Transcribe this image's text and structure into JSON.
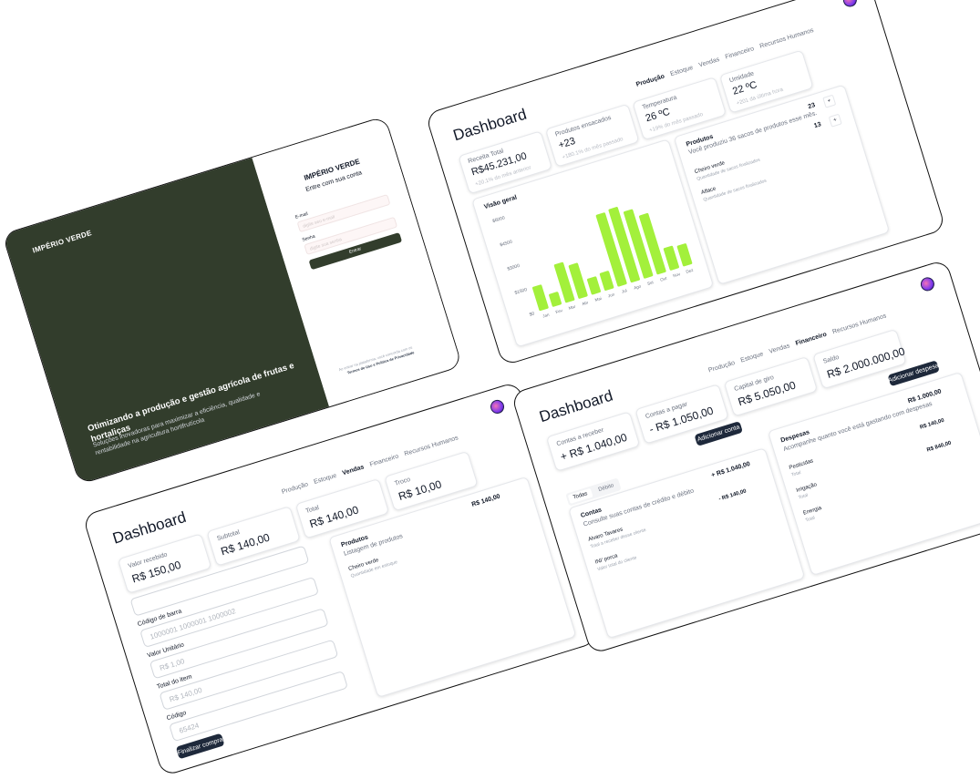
{
  "colors": {
    "brand_dark": "#323d2c",
    "accent_green": "#a3f03b",
    "button_dark": "#1e293b"
  },
  "login": {
    "brand": "IMPÉRIO VERDE",
    "headline": "Otimizando a produção e gestão agrícola de frutas e hortaliças",
    "tagline": "Soluções inovadoras para maximizar a eficiência, qualidade e rentabilidade na agricultura hortifrutícola",
    "form_brand": "IMPÉRIO VERDE",
    "form_subtitle": "Entre com sua conta",
    "email_label": "E-mail",
    "email_placeholder": "digite seu e-mail",
    "password_label": "Senha",
    "password_placeholder": "digite sua senha",
    "submit_label": "Entrar",
    "terms_line1": "Ao entrar na plataforma, você concorda com os",
    "terms_line2": "Termos de Uso e Política de Privacidade"
  },
  "production": {
    "nav": [
      "Produção",
      "Estoque",
      "Vendas",
      "Financeiro",
      "Recursos Humanos"
    ],
    "active_tab": "Produção",
    "title": "Dashboard",
    "kpis": [
      {
        "label": "Receita Total",
        "value": "R$45.231,00",
        "sub": "+20.1% do mês anterior"
      },
      {
        "label": "Produtos ensacados",
        "value": "+23",
        "sub": "+180.1% do mês passado"
      },
      {
        "label": "Temperatura",
        "value": "26 ºC",
        "sub": "+19% do mês passado"
      },
      {
        "label": "Umidade",
        "value": "22 ºC",
        "sub": "+201 da última hora"
      }
    ],
    "products_title": "Produtos",
    "products_desc": "Você produziu 36 sacos de produtos esse mês.",
    "products": [
      {
        "name": "Cheiro verde",
        "sub": "Quantidade de sacos finalizados",
        "qty": "23"
      },
      {
        "name": "Alface",
        "sub": "Quantidade de sacos finalizados",
        "qty": "13"
      }
    ]
  },
  "chart_data": {
    "type": "bar",
    "title": "Visão geral",
    "categories": [
      "Jan",
      "Fev",
      "Mar",
      "Abr",
      "Mai",
      "Jun",
      "Jul",
      "Ago",
      "Set",
      "Out",
      "Nov",
      "Dez"
    ],
    "values": [
      1500,
      800,
      2400,
      2100,
      1000,
      1100,
      4500,
      4600,
      4200,
      3700,
      1400,
      1300
    ],
    "yticks": [
      "$0",
      "$1500",
      "$3000",
      "$4500",
      "$6000"
    ],
    "ylim": [
      0,
      6000
    ],
    "color": "#a3f03b"
  },
  "sales": {
    "nav": [
      "Produção",
      "Estoque",
      "Vendas",
      "Financeiro",
      "Recursos Humanos"
    ],
    "active_tab": "Vendas",
    "title": "Dashboard",
    "kpis": [
      {
        "label": "Valor recebido",
        "value": "R$ 150,00"
      },
      {
        "label": "Subtotal",
        "value": "R$ 140,00"
      },
      {
        "label": "Total",
        "value": "R$ 140,00"
      },
      {
        "label": "Troco",
        "value": "R$ 10,00"
      }
    ],
    "fields": [
      {
        "label": "Código de barra",
        "placeholder": "1000001 1000001 1000002"
      },
      {
        "label": "Valor Unitário",
        "placeholder": "R$ 1,00"
      },
      {
        "label": "Total do item",
        "placeholder": "R$ 140,00"
      },
      {
        "label": "Código",
        "placeholder": "65424"
      }
    ],
    "finish_label": "Finalizar compra",
    "products_title": "Produtos",
    "products_total": "R$ 140,00",
    "products_desc": "Listagem de produtos",
    "item_name": "Cheiro verde",
    "item_sub": "Quantidade em estoque"
  },
  "finance": {
    "nav": [
      "Produção",
      "Estoque",
      "Vendas",
      "Financeiro",
      "Recursos Humanos"
    ],
    "active_tab": "Financeiro",
    "title": "Dashboard",
    "kpis": [
      {
        "label": "Contas a receber",
        "value": "+ R$ 1.040,00"
      },
      {
        "label": "Contas a pagar",
        "value": "- R$ 1.050,00"
      },
      {
        "label": "Capital de giro",
        "value": "R$ 5.050,00"
      },
      {
        "label": "Saldo",
        "value": "R$ 2.000.000,00"
      }
    ],
    "add_account_label": "Adicionar conta",
    "add_expense_label": "Adicionar despesa",
    "filters": [
      "Todas",
      "Débito"
    ],
    "accounts_title": "Contas",
    "accounts_desc": "Consulte suas contas de crédito e débito",
    "accounts_total": "+ R$ 1.040,00",
    "accounts": [
      {
        "name": "Alvaro Tavares",
        "sub": "Total a receber desse cliente",
        "value": "- R$ 140,00"
      },
      {
        "name": "INI' porca",
        "sub": "Valor total do cliente",
        "value": ""
      }
    ],
    "expenses_title": "Despesas",
    "expenses_desc": "Acompanhe quanto você está gastando com despesas",
    "expenses_total": "R$ 1.000,00",
    "expenses": [
      {
        "name": "Pesticidas",
        "sub": "Total",
        "value": "R$ 140,00"
      },
      {
        "name": "Irrigação",
        "sub": "Total",
        "value": "R$ 840,00"
      },
      {
        "name": "Energia",
        "sub": "Total",
        "value": ""
      }
    ]
  }
}
